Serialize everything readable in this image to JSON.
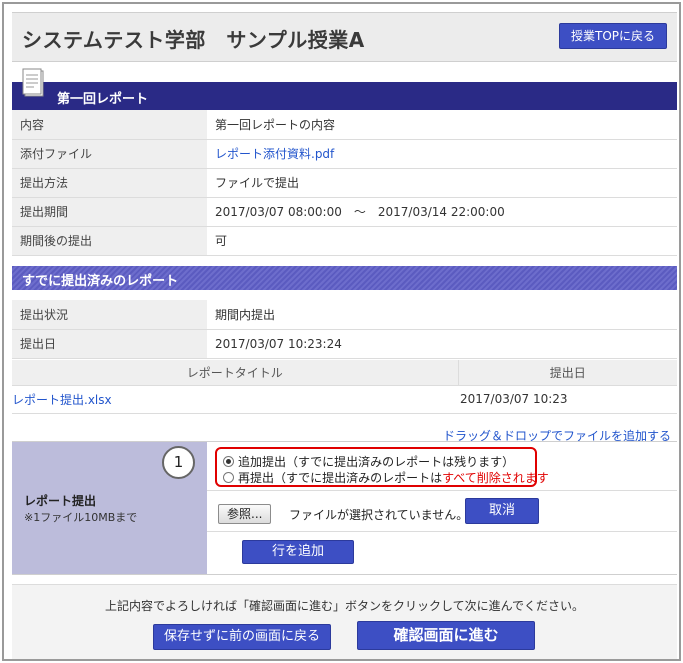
{
  "header": {
    "title": "システムテスト学部　サンプル授業A",
    "top_button": "授業TOPに戻る"
  },
  "report_section": {
    "title": "第一回レポート",
    "rows": [
      {
        "label": "内容",
        "value": "第一回レポートの内容"
      },
      {
        "label": "添付ファイル",
        "value": "レポート添付資料.pdf"
      },
      {
        "label": "提出方法",
        "value": "ファイルで提出"
      },
      {
        "label": "提出期間",
        "value": "2017/03/07 08:00:00　〜　2017/03/14 22:00:00"
      },
      {
        "label": "期間後の提出",
        "value": "可"
      }
    ]
  },
  "submitted_section": {
    "title": "すでに提出済みのレポート",
    "rows": [
      {
        "label": "提出状況",
        "value": "期間内提出"
      },
      {
        "label": "提出日",
        "value": "2017/03/07 10:23:24"
      }
    ],
    "table": {
      "headers": [
        "レポートタイトル",
        "提出日"
      ],
      "rows": [
        {
          "title": "レポート提出.xlsx",
          "date": "2017/03/07 10:23"
        }
      ]
    }
  },
  "upload": {
    "dnd_link": "ドラッグ＆ドロップでファイルを追加する",
    "label": "レポート提出",
    "note": "※1ファイル10MBまで",
    "callout_number": "1",
    "option_add": "追加提出（すでに提出済みのレポートは残ります）",
    "option_resubmit_prefix": "再提出（すでに提出済みのレポートは",
    "option_resubmit_warning": "すべて削除されます",
    "browse_button": "参照...",
    "no_file_text": "ファイルが選択されていません。",
    "cancel_button": "取消",
    "add_row_button": "行を追加"
  },
  "footer": {
    "message": "上記内容でよろしければ「確認画面に進む」ボタンをクリックして次に進んでください。",
    "back_button": "保存せずに前の画面に戻る",
    "confirm_button": "確認画面に進む"
  },
  "colors": {
    "accent": "#3d4fc4",
    "section_bar": "#2a2a86",
    "warning": "#e00000"
  }
}
